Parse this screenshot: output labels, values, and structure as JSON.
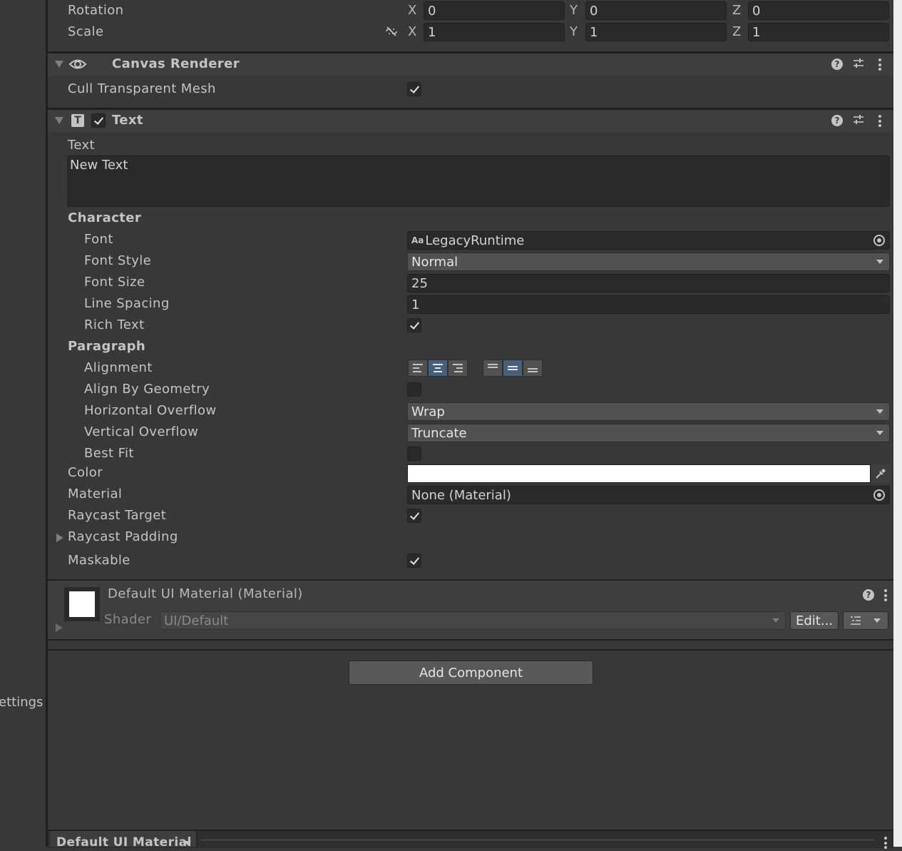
{
  "left_panel": {
    "settings_label": "ettings"
  },
  "transform": {
    "rotation_label": "Rotation",
    "scale_label": "Scale",
    "rotation": {
      "x": "0",
      "y": "0",
      "z": "0"
    },
    "scale": {
      "x": "1",
      "y": "1",
      "z": "1"
    },
    "axis_x": "X",
    "axis_y": "Y",
    "axis_z": "Z"
  },
  "canvas_renderer": {
    "title": "Canvas Renderer",
    "cull_label": "Cull Transparent Mesh",
    "cull_checked": true
  },
  "text_component": {
    "title": "Text",
    "enabled": true,
    "text_label": "Text",
    "text_value": "New Text",
    "character_header": "Character",
    "font_label": "Font",
    "font_value": "LegacyRuntime",
    "font_icon_text": "Aa",
    "font_style_label": "Font Style",
    "font_style_value": "Normal",
    "font_size_label": "Font Size",
    "font_size_value": "25",
    "line_spacing_label": "Line Spacing",
    "line_spacing_value": "1",
    "rich_text_label": "Rich Text",
    "rich_text_checked": true,
    "paragraph_header": "Paragraph",
    "alignment_label": "Alignment",
    "horizontal_alignment": [
      "left",
      "center",
      "right"
    ],
    "horizontal_alignment_selected": "center",
    "vertical_alignment": [
      "top",
      "middle",
      "bottom"
    ],
    "vertical_alignment_selected": "middle",
    "align_geometry_label": "Align By Geometry",
    "align_geometry_checked": false,
    "h_overflow_label": "Horizontal Overflow",
    "h_overflow_value": "Wrap",
    "v_overflow_label": "Vertical Overflow",
    "v_overflow_value": "Truncate",
    "best_fit_label": "Best Fit",
    "best_fit_checked": false,
    "color_label": "Color",
    "color_value": "#ffffff",
    "material_label": "Material",
    "material_value": "None (Material)",
    "raycast_target_label": "Raycast Target",
    "raycast_target_checked": true,
    "raycast_padding_label": "Raycast Padding",
    "maskable_label": "Maskable",
    "maskable_checked": true
  },
  "material_preview": {
    "title": "Default UI Material (Material)",
    "shader_label": "Shader",
    "shader_value": "UI/Default",
    "edit_button": "Edit..."
  },
  "add_component_button": "Add Component",
  "bottom_bar": {
    "label": "Default UI Material"
  },
  "colors": {
    "accent": "#46607c",
    "background": "#383838",
    "field": "#2a2a2a"
  }
}
